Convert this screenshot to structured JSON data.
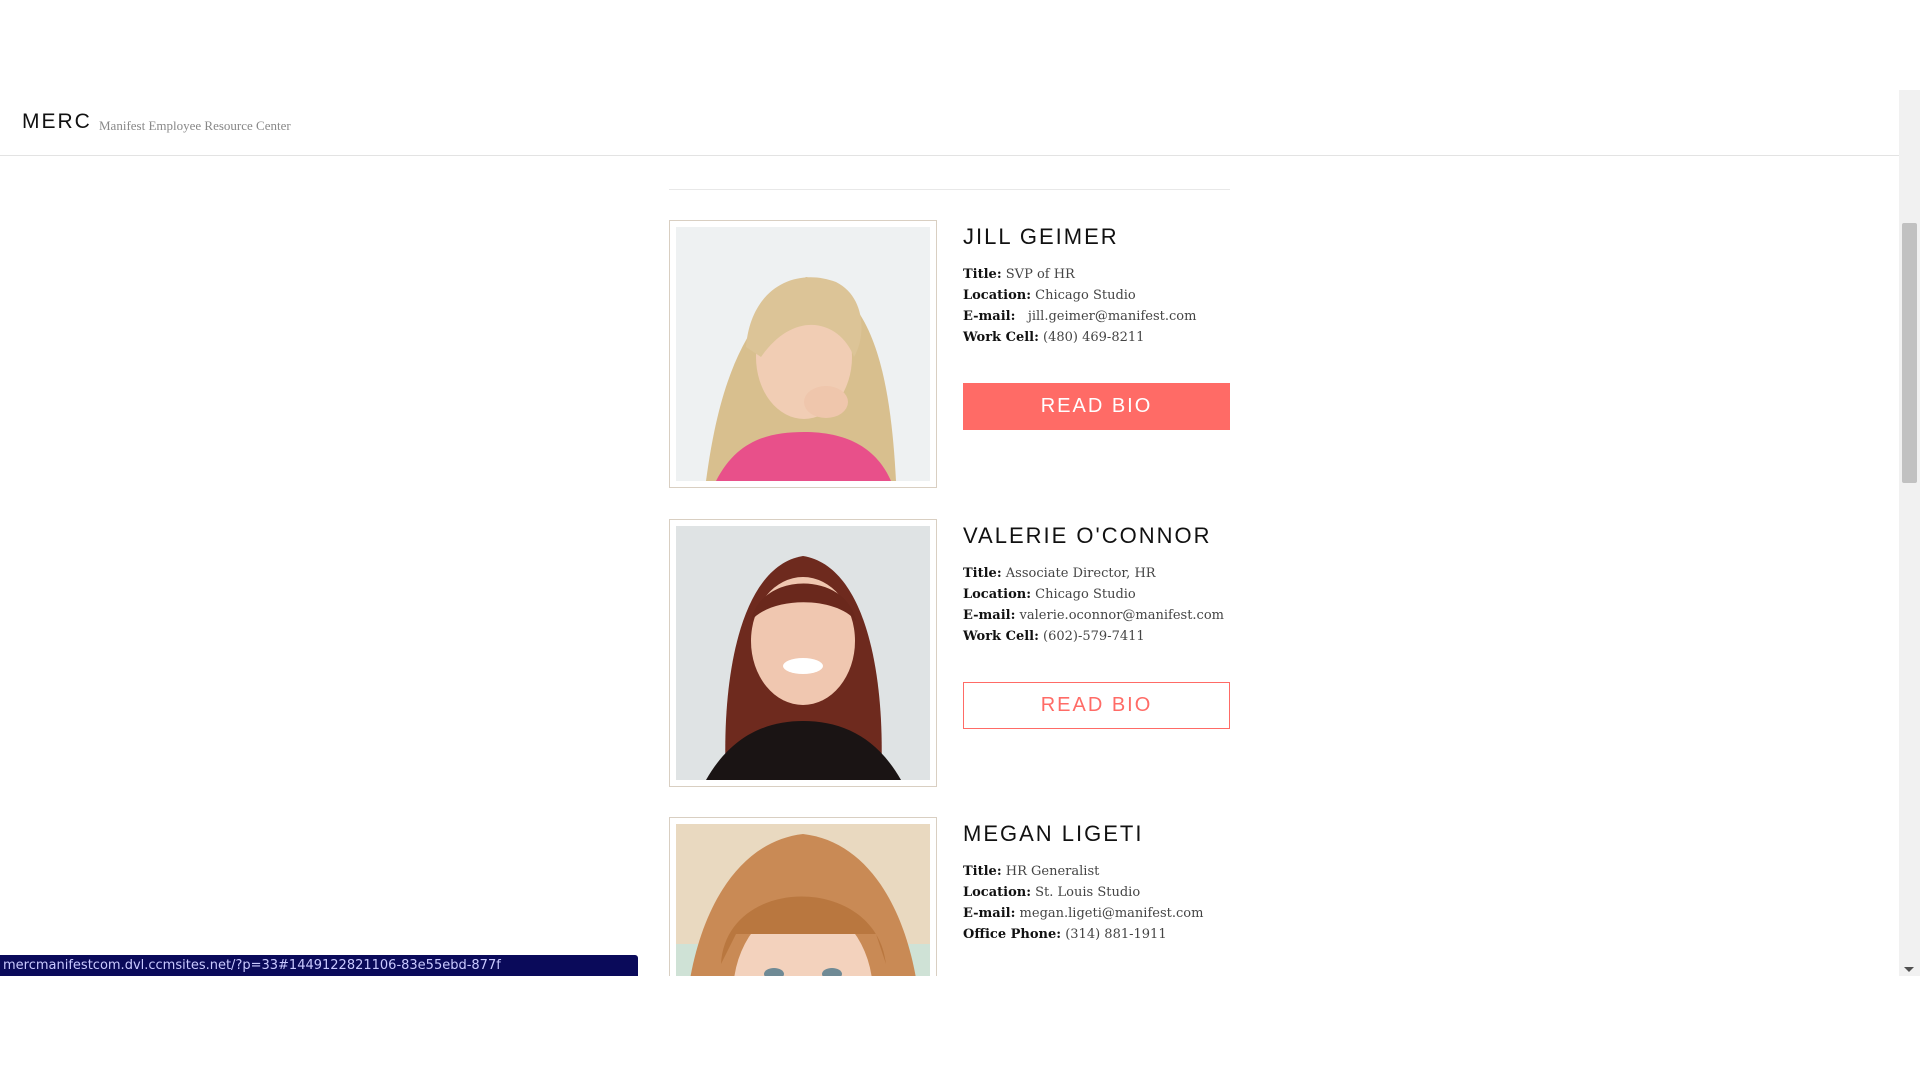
{
  "header": {
    "logo": "MERC",
    "tagline": "Manifest Employee Resource Center"
  },
  "employees": [
    {
      "name": "JILL GEIMER",
      "title_label": "Title:",
      "title": "SVP of HR",
      "location_label": "Location:",
      "location": "Chicago Studio",
      "email_label": "E-mail:",
      "email": "jill.geimer@manifest.com",
      "phone_label": "Work Cell:",
      "phone": "(480) 469-8211",
      "button": "READ BIO"
    },
    {
      "name": "VALERIE O'CONNOR",
      "title_label": "Title:",
      "title": "Associate Director, HR",
      "location_label": "Location:",
      "location": "Chicago Studio",
      "email_label": "E-mail:",
      "email": "valerie.oconnor@manifest.com",
      "phone_label": "Work Cell:",
      "phone": "(602)-579-7411",
      "button": "READ BIO"
    },
    {
      "name": "MEGAN LIGETI",
      "title_label": "Title:",
      "title": "HR Generalist",
      "location_label": "Location:",
      "location": "St. Louis Studio",
      "email_label": "E-mail:",
      "email": "megan.ligeti@manifest.com",
      "phone_label": "Office Phone:",
      "phone": "(314) 881-1911"
    }
  ],
  "status_bar": {
    "url": "mercmanifestcom.dvl.ccmsites.net/?p=33#1449122821106-83e55ebd-877f"
  },
  "colors": {
    "accent": "#ff6b66",
    "status_bar": "#0a0a5a"
  }
}
